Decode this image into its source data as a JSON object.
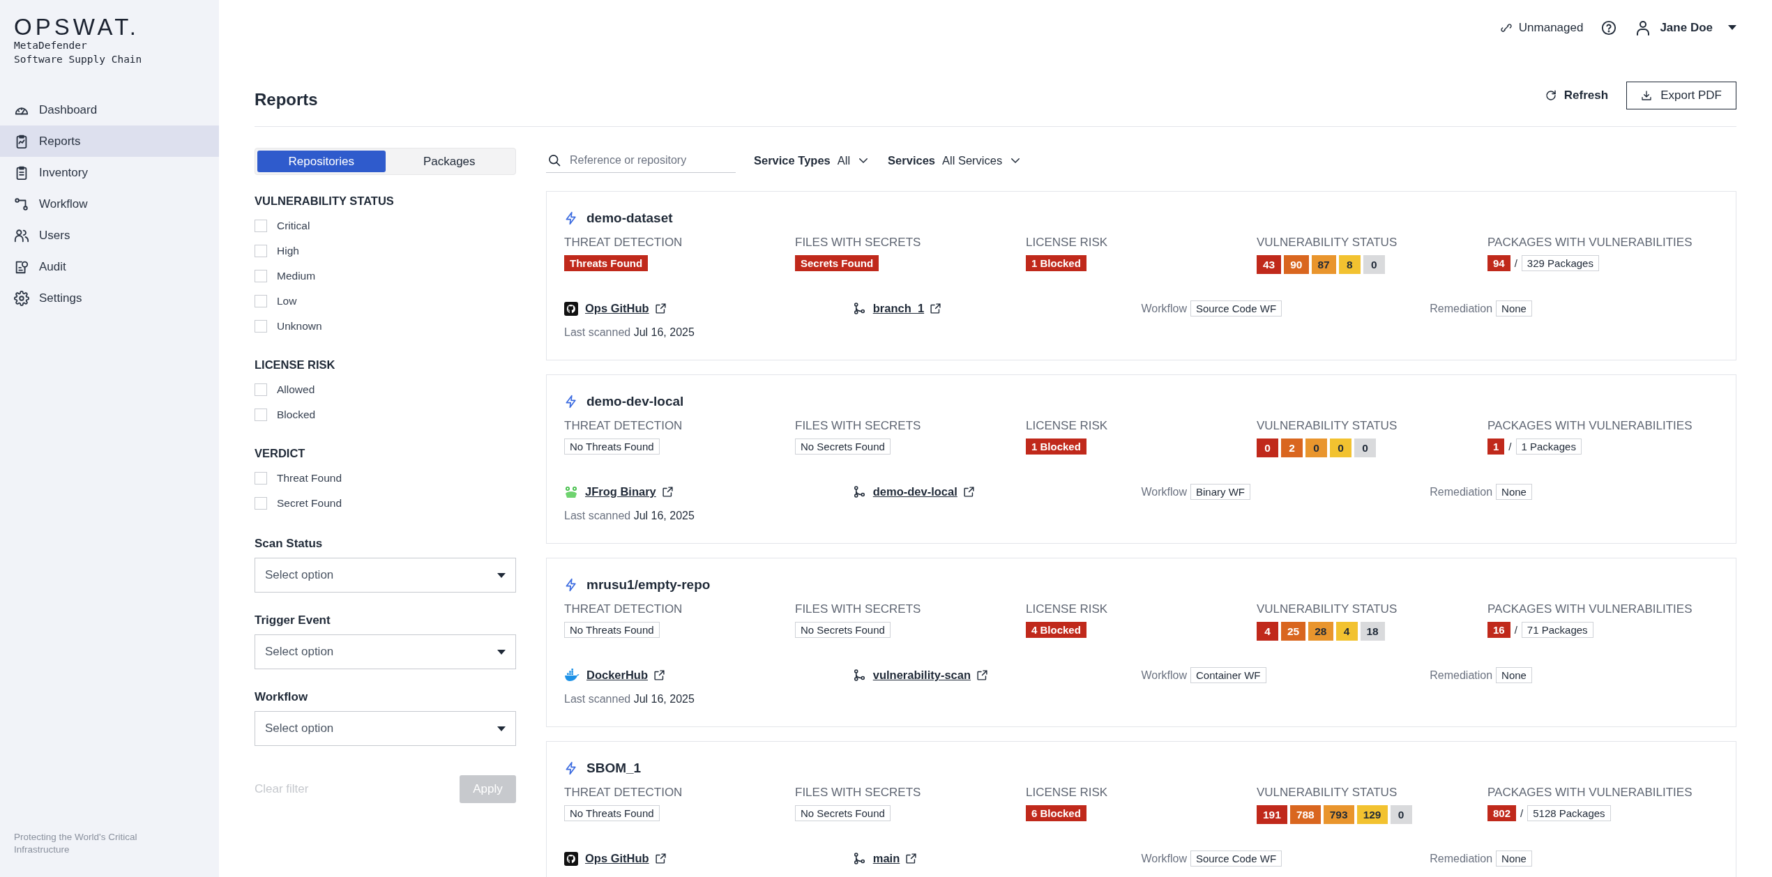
{
  "sidebar": {
    "logo": "OPSWAT.",
    "product": "MetaDefender",
    "subtitle": "Software Supply Chain",
    "items": [
      {
        "kind": "dashboard",
        "label": "Dashboard",
        "selected": false
      },
      {
        "kind": "reports",
        "label": "Reports",
        "selected": true
      },
      {
        "kind": "inventory",
        "label": "Inventory",
        "selected": false
      },
      {
        "kind": "workflow",
        "label": "Workflow",
        "selected": false
      },
      {
        "kind": "users",
        "label": "Users",
        "selected": false
      },
      {
        "kind": "audit",
        "label": "Audit",
        "selected": false
      },
      {
        "kind": "settings",
        "label": "Settings",
        "selected": false
      }
    ],
    "footer": "Protecting the World's Critical Infrastructure"
  },
  "topbar": {
    "status": "Unmanaged",
    "user": "Jane Doe"
  },
  "page": {
    "title": "Reports",
    "refresh": "Refresh",
    "export": "Export PDF"
  },
  "filters": {
    "tabs": [
      {
        "label": "Repositories",
        "selected": true
      },
      {
        "label": "Packages",
        "selected": false
      }
    ],
    "groups": [
      {
        "title": "VULNERABILITY STATUS",
        "options": [
          {
            "label": "Critical",
            "checked": false
          },
          {
            "label": "High",
            "checked": false
          },
          {
            "label": "Medium",
            "checked": false
          },
          {
            "label": "Low",
            "checked": false
          },
          {
            "label": "Unknown",
            "checked": false
          }
        ]
      },
      {
        "title": "LICENSE RISK",
        "options": [
          {
            "label": "Allowed",
            "checked": false
          },
          {
            "label": "Blocked",
            "checked": false
          }
        ]
      },
      {
        "title": "VERDICT",
        "options": [
          {
            "label": "Threat Found",
            "checked": false
          },
          {
            "label": "Secret Found",
            "checked": false
          }
        ]
      }
    ],
    "selects": [
      {
        "label": "Scan Status",
        "placeholder": "Select option"
      },
      {
        "label": "Trigger Event",
        "placeholder": "Select option"
      },
      {
        "label": "Workflow",
        "placeholder": "Select option"
      }
    ],
    "clear": {
      "label": "Clear filter",
      "disabled": true
    },
    "apply": {
      "label": "Apply",
      "disabled": true
    }
  },
  "toolbar": {
    "search": {
      "placeholder": "Reference or repository"
    },
    "dropdowns": [
      {
        "label": "Service Types",
        "value": "All"
      },
      {
        "label": "Services",
        "value": "All Services"
      }
    ]
  },
  "reports": [
    {
      "name": "demo-dataset",
      "threat": {
        "label": "THREAT DETECTION",
        "value": "Threats Found",
        "found": true
      },
      "secrets": {
        "label": "FILES WITH SECRETS",
        "value": "Secrets Found",
        "found": true
      },
      "license": {
        "label": "LICENSE RISK",
        "value": "1 Blocked"
      },
      "vulnerabilities": {
        "label": "VULNERABILITY STATUS",
        "counts": [
          {
            "kind": "critical",
            "count": "43"
          },
          {
            "kind": "high",
            "count": "90"
          },
          {
            "kind": "medium",
            "count": "87"
          },
          {
            "kind": "low",
            "count": "8"
          },
          {
            "kind": "unknown",
            "count": "0"
          }
        ]
      },
      "packages": {
        "label": "PACKAGES WITH VULNERABILITIES",
        "vulnerable": "94",
        "separator": "/",
        "total": "329 Packages"
      },
      "source": {
        "kind": "github",
        "name": "Ops GitHub"
      },
      "branch": "branch_1",
      "workflow": {
        "label": "Workflow",
        "value": "Source Code WF"
      },
      "remediation": {
        "label": "Remediation",
        "value": "None"
      },
      "last_scanned": {
        "label": "Last scanned",
        "date": "Jul 16, 2025"
      }
    },
    {
      "name": "demo-dev-local",
      "threat": {
        "label": "THREAT DETECTION",
        "value": "No Threats Found",
        "found": false
      },
      "secrets": {
        "label": "FILES WITH SECRETS",
        "value": "No Secrets Found",
        "found": false
      },
      "license": {
        "label": "LICENSE RISK",
        "value": "1 Blocked"
      },
      "vulnerabilities": {
        "label": "VULNERABILITY STATUS",
        "counts": [
          {
            "kind": "critical",
            "count": "0"
          },
          {
            "kind": "high",
            "count": "2"
          },
          {
            "kind": "medium",
            "count": "0"
          },
          {
            "kind": "low",
            "count": "0"
          },
          {
            "kind": "unknown",
            "count": "0"
          }
        ]
      },
      "packages": {
        "label": "PACKAGES WITH VULNERABILITIES",
        "vulnerable": "1",
        "separator": "/",
        "total": "1 Packages"
      },
      "source": {
        "kind": "jfrog",
        "name": "JFrog Binary"
      },
      "branch": "demo-dev-local",
      "workflow": {
        "label": "Workflow",
        "value": "Binary WF"
      },
      "remediation": {
        "label": "Remediation",
        "value": "None"
      },
      "last_scanned": {
        "label": "Last scanned",
        "date": "Jul 16, 2025"
      }
    },
    {
      "name": "mrusu1/empty-repo",
      "threat": {
        "label": "THREAT DETECTION",
        "value": "No Threats Found",
        "found": false
      },
      "secrets": {
        "label": "FILES WITH SECRETS",
        "value": "No Secrets Found",
        "found": false
      },
      "license": {
        "label": "LICENSE RISK",
        "value": "4 Blocked"
      },
      "vulnerabilities": {
        "label": "VULNERABILITY STATUS",
        "counts": [
          {
            "kind": "critical",
            "count": "4"
          },
          {
            "kind": "high",
            "count": "25"
          },
          {
            "kind": "medium",
            "count": "28"
          },
          {
            "kind": "low",
            "count": "4"
          },
          {
            "kind": "unknown",
            "count": "18"
          }
        ]
      },
      "packages": {
        "label": "PACKAGES WITH VULNERABILITIES",
        "vulnerable": "16",
        "separator": "/",
        "total": "71 Packages"
      },
      "source": {
        "kind": "docker",
        "name": "DockerHub"
      },
      "branch": "vulnerability-scan",
      "workflow": {
        "label": "Workflow",
        "value": "Container WF"
      },
      "remediation": {
        "label": "Remediation",
        "value": "None"
      },
      "last_scanned": {
        "label": "Last scanned",
        "date": "Jul 16, 2025"
      }
    },
    {
      "name": "SBOM_1",
      "threat": {
        "label": "THREAT DETECTION",
        "value": "No Threats Found",
        "found": false
      },
      "secrets": {
        "label": "FILES WITH SECRETS",
        "value": "No Secrets Found",
        "found": false
      },
      "license": {
        "label": "LICENSE RISK",
        "value": "6 Blocked"
      },
      "vulnerabilities": {
        "label": "VULNERABILITY STATUS",
        "counts": [
          {
            "kind": "critical",
            "count": "191"
          },
          {
            "kind": "high",
            "count": "788"
          },
          {
            "kind": "medium",
            "count": "793"
          },
          {
            "kind": "low",
            "count": "129"
          },
          {
            "kind": "unknown",
            "count": "0"
          }
        ]
      },
      "packages": {
        "label": "PACKAGES WITH VULNERABILITIES",
        "vulnerable": "802",
        "separator": "/",
        "total": "5128 Packages"
      },
      "source": {
        "kind": "github",
        "name": "Ops GitHub"
      },
      "branch": "main",
      "workflow": {
        "label": "Workflow",
        "value": "Source Code WF"
      },
      "remediation": {
        "label": "Remediation",
        "value": "None"
      }
    }
  ]
}
